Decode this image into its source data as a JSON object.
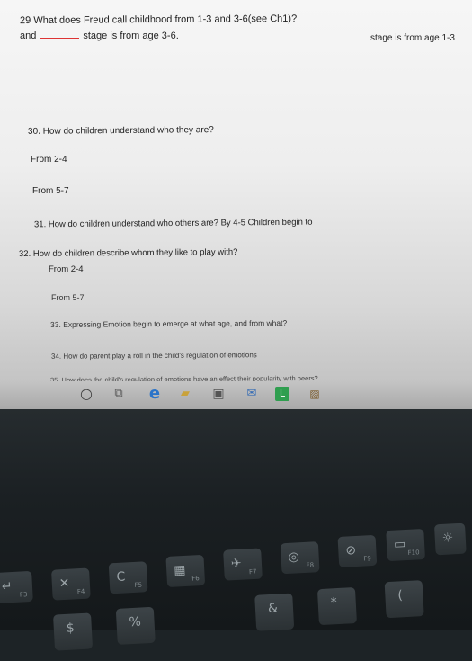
{
  "document": {
    "q29_line1": "29 What does Freud call childhood from 1-3 and 3-6(see Ch1)?",
    "q29_right": "stage is from age 1-3",
    "q29_and": "and",
    "q29_line2": "stage is from age 3-6.",
    "q30": "30. How do children understand who they are?",
    "q30_a": "From 2-4",
    "q30_b": "From 5-7",
    "q31": "31. How do children understand who others are?  By 4-5 Children begin to",
    "q32": "32. How do children describe whom they like to play with?",
    "q32_a": "From 2-4",
    "q32_b": "From 5-7",
    "q33": "33. Expressing Emotion begin to emerge at what age, and from what?",
    "q34": "34. How do parent play a roll in the child's regulation of emotions",
    "q35": "35. How does the child's regulation of emotions have an effect their popularity with peers?"
  },
  "taskbar": {
    "icons": [
      "start-circle-icon",
      "task-view-icon",
      "edge-icon",
      "file-explorer-icon",
      "store-icon",
      "mail-icon",
      "app-l-icon",
      "photos-icon"
    ],
    "app_letter": "L"
  },
  "keyboard": {
    "fn_keys": [
      {
        "glyph": "↵",
        "fn": "F3"
      },
      {
        "glyph": "✕",
        "fn": "F4"
      },
      {
        "glyph": "C",
        "fn": "F5"
      },
      {
        "glyph": "▦",
        "fn": "F6"
      },
      {
        "glyph": "✈",
        "fn": "F7"
      },
      {
        "glyph": "◎",
        "fn": "F8"
      },
      {
        "glyph": "⊘",
        "fn": "F9"
      },
      {
        "glyph": "▭",
        "fn": "F10"
      },
      {
        "glyph": "☼",
        "fn": ""
      }
    ],
    "num_keys": [
      "$",
      "%",
      "&",
      "*",
      "("
    ]
  },
  "colors": {
    "blank_line": "#dd3333",
    "edge_blue": "#2b74c9",
    "app_green": "#2f9e4f"
  }
}
